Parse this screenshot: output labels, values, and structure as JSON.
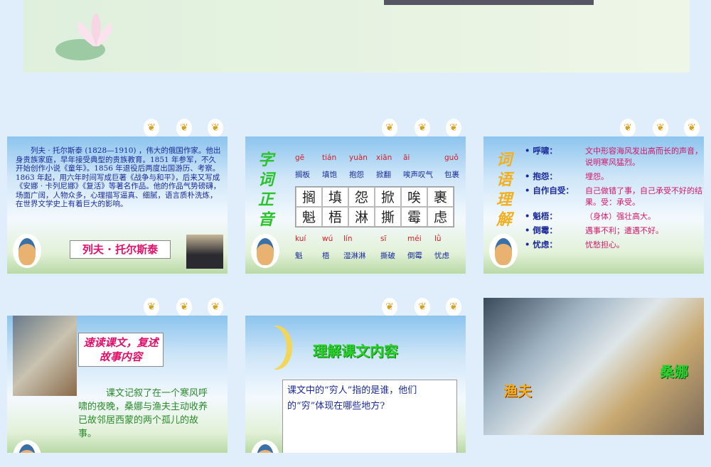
{
  "slide1": {
    "bio": "列夫 · 托尔斯泰 (1828—1910) ，伟大的俄国作家。他出身贵族家庭，早年接受典型的贵族教育。1851 年参军，不久开始创作小说《童年》。1856 年退役后两度出国游历、考察。1863 年起，用六年时间写成巨著《战争与和平》，后来又写成《安娜 · 卡列尼娜》《复活》等著名作品。他的作品气势磅礴，场面广阔，人物众多，心理描写逼真、细腻，语言质朴洗炼，在世界文学史上有着巨大的影响。",
    "name": "列夫 · 托尔斯泰"
  },
  "slide2": {
    "title": "字词正音",
    "pinyin_top": [
      "gē",
      "tián",
      "yuàn",
      "xiān",
      "āi",
      "guǒ"
    ],
    "words_top": [
      "搁板",
      "填饱",
      "抱怨",
      "掀翻",
      "唉声叹气",
      "包裹"
    ],
    "grid": [
      "搁",
      "填",
      "怨",
      "掀",
      "唉",
      "裹",
      "魁",
      "梧",
      "淋",
      "撕",
      "霉",
      "虑"
    ],
    "pinyin_bottom": [
      "kuí",
      "wú",
      "lín",
      "sī",
      "méi",
      "lǜ"
    ],
    "words_bottom": [
      "魁",
      "梧",
      "湿淋淋",
      "撕破",
      "倒霉",
      "忧虑"
    ]
  },
  "slide3": {
    "title": "词语理解",
    "items": [
      {
        "term": "• 呼啸：",
        "def": "文中形容海风发出高而长的声音，说明寒风猛烈。"
      },
      {
        "term": "• 抱怨：",
        "def": "埋怨。"
      },
      {
        "term": "• 自作自受：",
        "def": "自己做错了事，自己承受不好的结果。受：承受。"
      },
      {
        "term": "• 魁梧：",
        "def": "（身体）强壮高大。"
      },
      {
        "term": "• 倒霉：",
        "def": "遇事不利；遭遇不好。"
      },
      {
        "term": "• 忧虑：",
        "def": "忧愁担心。"
      }
    ]
  },
  "slide4": {
    "heading": "速读课文，复述故事内容",
    "body": "课文记叙了在一个寒风呼啸的夜晚，桑娜与渔夫主动收养已故邻居西蒙的两个孤儿的故事。"
  },
  "slide5": {
    "title": "理解课文内容",
    "question": "课文中的“穷人”指的是谁，他们的“穷”体现在哪些地方?"
  },
  "slide6": {
    "label_left": "渔夫",
    "label_right": "桑娜"
  },
  "icons": {
    "butterfly": "butterfly-icon"
  }
}
